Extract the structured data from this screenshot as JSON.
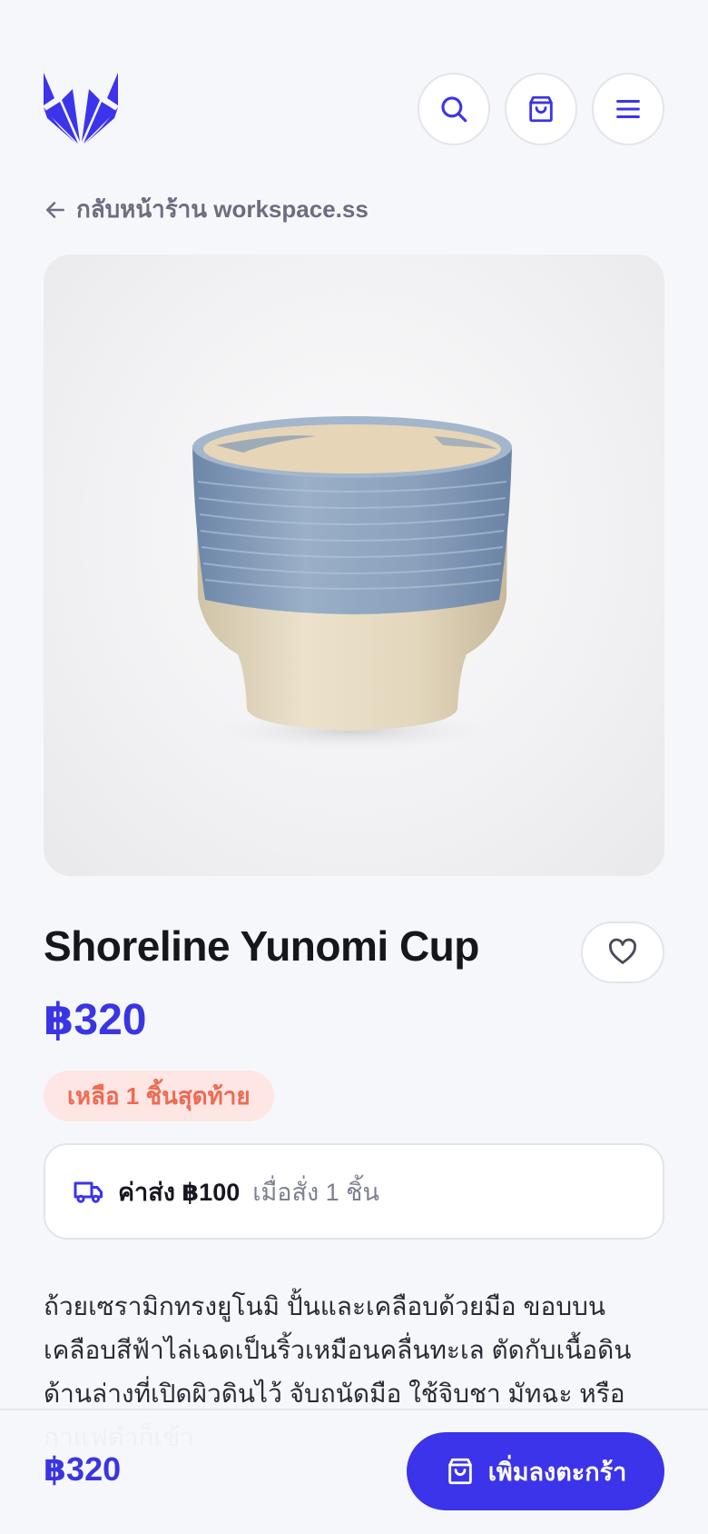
{
  "header": {
    "logo": "fox-logo",
    "search_icon": "search-icon",
    "cart_icon": "shopping-bag-icon",
    "menu_icon": "menu-icon"
  },
  "back_link": {
    "icon": "arrow-left-icon",
    "label": "กลับหน้าร้าน workspace.ss"
  },
  "product": {
    "image": "ceramic-yunomi-cup-photo",
    "title": "Shoreline Yunomi Cup",
    "price": "฿320",
    "stock_badge": "เหลือ 1 ชิ้นสุดท้าย",
    "favorite_icon": "heart-icon",
    "shipping": {
      "icon": "truck-icon",
      "label": "ค่าส่ง ฿100",
      "note": "เมื่อสั่ง 1 ชิ้น"
    },
    "description": "ถ้วยเซรามิกทรงยูโนมิ ปั้นและเคลือบด้วยมือ ขอบบนเคลือบสีฟ้าไล่เฉดเป็นริ้วเหมือนคลื่นทะเล ตัดกับเนื้อดินด้านล่างที่เปิดผิวดินไว้ จับถนัดมือ ใช้จิบชา มัทฉะ หรือกาแฟดำก็เข้า"
  },
  "bottom_bar": {
    "price": "฿320",
    "button_icon": "shopping-bag-icon",
    "button_label": "เพิ่มลงตะกร้า"
  },
  "colors": {
    "accent": "#3b34ea",
    "price": "#3a35e3",
    "badge_bg": "#fde6e4",
    "badge_text": "#ef6a52",
    "background": "#f6f7fb"
  }
}
